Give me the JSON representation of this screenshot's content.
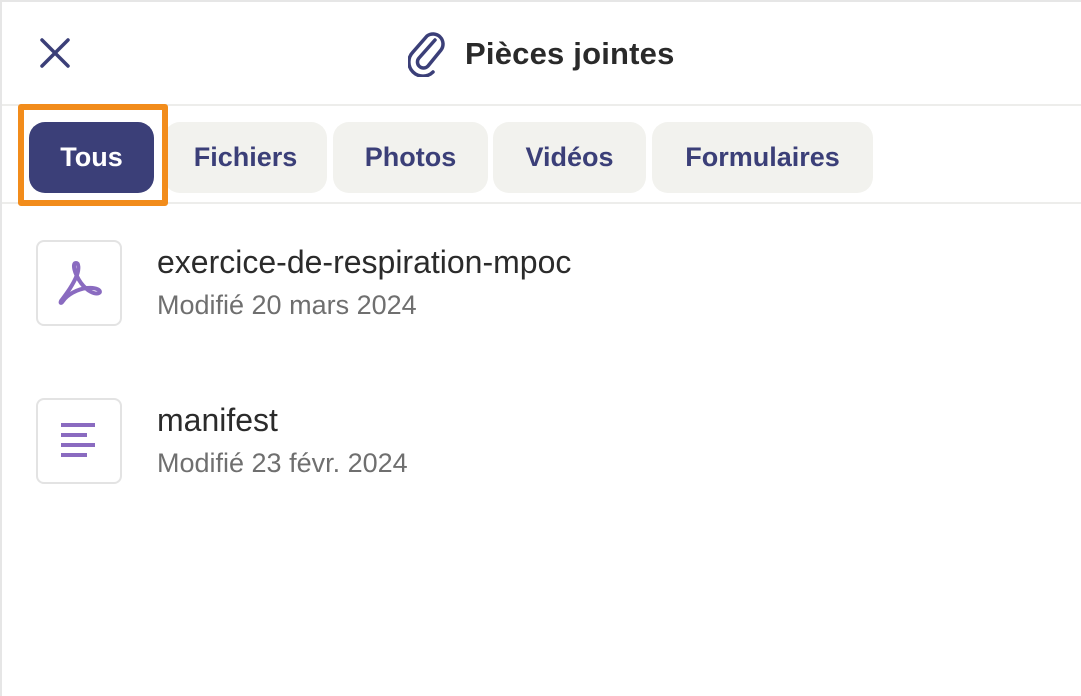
{
  "header": {
    "title": "Pièces jointes",
    "close_icon": "close-icon",
    "title_icon": "paperclip-icon"
  },
  "tabs": [
    {
      "label": "Tous",
      "active": true
    },
    {
      "label": "Fichiers",
      "active": false
    },
    {
      "label": "Photos",
      "active": false
    },
    {
      "label": "Vidéos",
      "active": false
    },
    {
      "label": "Formulaires",
      "active": false
    }
  ],
  "files": [
    {
      "name": "exercice-de-respiration-mpoc",
      "modified": "Modifié 20 mars 2024",
      "icon": "pdf-icon"
    },
    {
      "name": "manifest",
      "modified": "Modifié 23 févr. 2024",
      "icon": "text-document-icon"
    }
  ],
  "colors": {
    "accent": "#3b3f78",
    "tab_bg": "#f2f2ee",
    "highlight": "#f28c1b",
    "file_icon": "#8a6bc0"
  }
}
